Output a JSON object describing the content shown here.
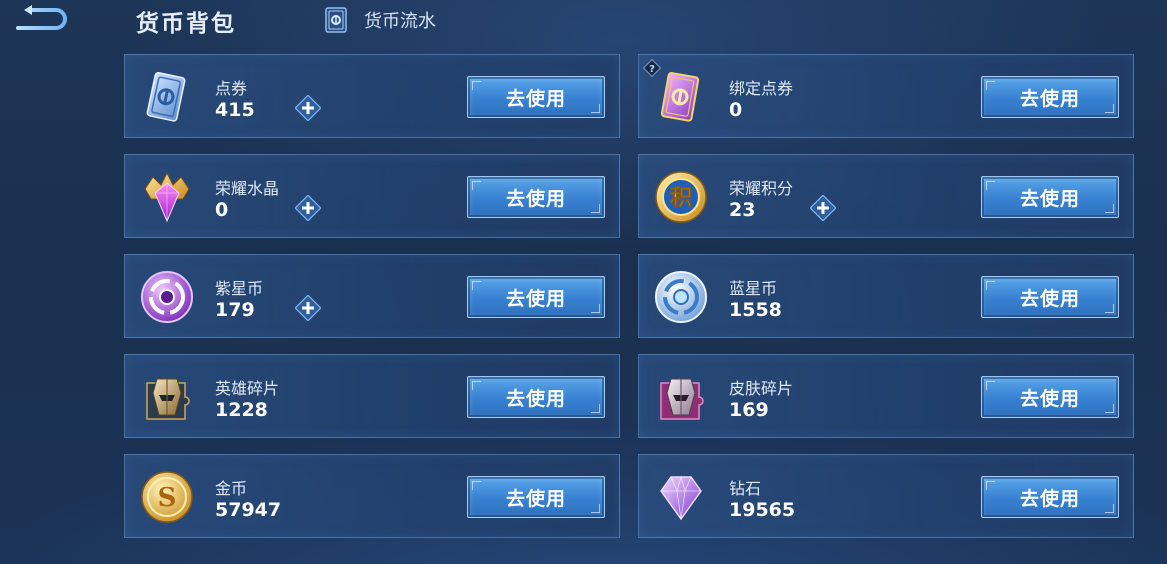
{
  "header": {
    "title": "货币背包",
    "flow_link": "货币流水"
  },
  "colors": {
    "accent": "#3a84d3",
    "background": "#1b3356",
    "card_border": "#78aae6"
  },
  "currencies": [
    {
      "name": "点券",
      "value": "415",
      "icon": "voucher-icon",
      "has_add": true,
      "button": "去使用"
    },
    {
      "name": "绑定点券",
      "value": "0",
      "icon": "bound-voucher-icon",
      "has_add": false,
      "has_help": true,
      "button": "去使用"
    },
    {
      "name": "荣耀水晶",
      "value": "0",
      "icon": "glory-crystal-icon",
      "has_add": true,
      "button": "去使用"
    },
    {
      "name": "荣耀积分",
      "value": "23",
      "icon": "glory-points-icon",
      "icon_text": "积",
      "has_add": true,
      "button": "去使用"
    },
    {
      "name": "紫星币",
      "value": "179",
      "icon": "purple-star-coin-icon",
      "has_add": true,
      "button": "去使用"
    },
    {
      "name": "蓝星币",
      "value": "1558",
      "icon": "blue-star-coin-icon",
      "has_add": false,
      "button": "去使用"
    },
    {
      "name": "英雄碎片",
      "value": "1228",
      "icon": "hero-fragment-icon",
      "has_add": false,
      "button": "去使用"
    },
    {
      "name": "皮肤碎片",
      "value": "169",
      "icon": "skin-fragment-icon",
      "has_add": false,
      "button": "去使用"
    },
    {
      "name": "金币",
      "value": "57947",
      "icon": "gold-coin-icon",
      "icon_text": "S",
      "has_add": false,
      "button": "去使用"
    },
    {
      "name": "钻石",
      "value": "19565",
      "icon": "diamond-icon",
      "has_add": false,
      "button": "去使用"
    }
  ]
}
